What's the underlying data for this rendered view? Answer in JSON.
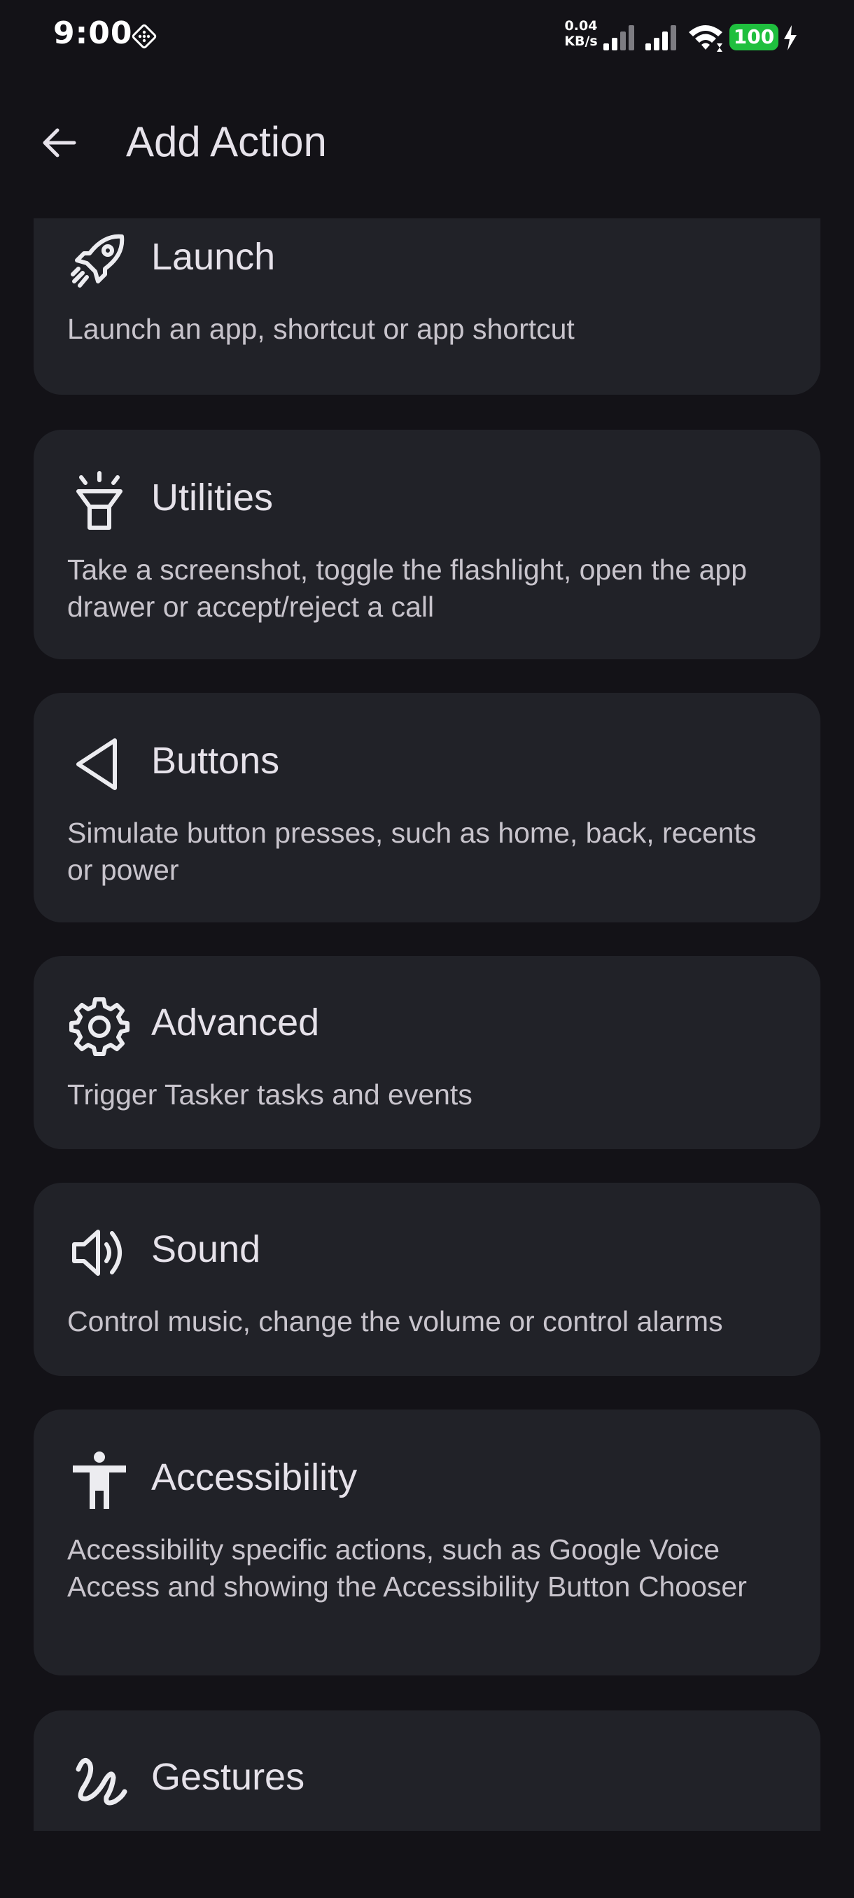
{
  "status_bar": {
    "time": "9:00",
    "net_speed_value": "0.04",
    "net_speed_unit": "KB/s",
    "battery": "100",
    "icons": [
      "notification-icon",
      "signal-icon",
      "signal-icon",
      "wifi-icon",
      "charging-icon"
    ],
    "battery_color": "#1fbf3e"
  },
  "app_bar": {
    "back_icon": "arrow-back-icon",
    "title": "Add Action"
  },
  "categories": [
    {
      "title": "Launch",
      "description": "Launch an app, shortcut or app shortcut",
      "icon": "rocket-icon"
    },
    {
      "title": "Utilities",
      "description": "Take a screenshot, toggle the flashlight, open the app drawer or accept/reject a call",
      "icon": "flashlight-icon"
    },
    {
      "title": "Buttons",
      "description": "Simulate button presses, such as home, back, recents or power",
      "icon": "triangle-back-icon"
    },
    {
      "title": "Advanced",
      "description": "Trigger Tasker tasks and events",
      "icon": "gear-icon"
    },
    {
      "title": "Sound",
      "description": "Control music, change the volume or control alarms",
      "icon": "volume-icon"
    },
    {
      "title": "Accessibility",
      "description": "Accessibility specific actions, such as Google Voice Access and showing the Accessibility Button Chooser",
      "icon": "accessibility-icon"
    },
    {
      "title": "Gestures",
      "description": "",
      "icon": "gesture-icon"
    }
  ],
  "colors": {
    "background": "#131217",
    "card": "#212228",
    "text_primary": "#e6e2ea",
    "text_secondary": "#c8c4cc"
  }
}
